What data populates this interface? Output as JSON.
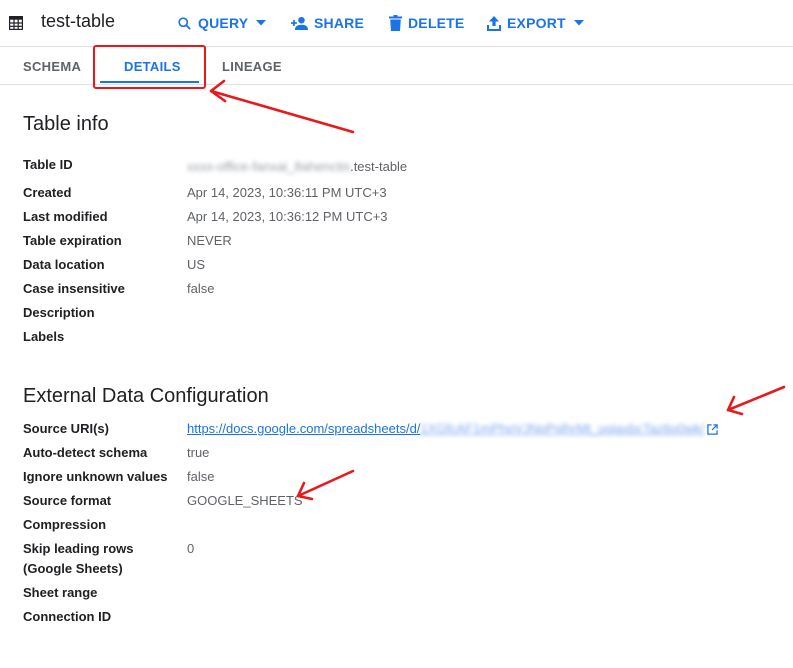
{
  "header": {
    "title": "test-table",
    "actions": {
      "query": "QUERY",
      "share": "SHARE",
      "delete": "DELETE",
      "export": "EXPORT"
    }
  },
  "tabs": {
    "schema": "SCHEMA",
    "details": "DETAILS",
    "lineage": "LINEAGE",
    "active": "DETAILS"
  },
  "table_info": {
    "title": "Table info",
    "rows": [
      {
        "label": "Table ID",
        "value_prefix": "xxxx-office-fanxai_8ahenctis",
        "value": ".test-table"
      },
      {
        "label": "Created",
        "value": "Apr 14, 2023, 10:36:11 PM UTC+3"
      },
      {
        "label": "Last modified",
        "value": "Apr 14, 2023, 10:36:12 PM UTC+3"
      },
      {
        "label": "Table expiration",
        "value": "NEVER"
      },
      {
        "label": "Data location",
        "value": "US"
      },
      {
        "label": "Case insensitive",
        "value": "false"
      },
      {
        "label": "Description",
        "value": ""
      },
      {
        "label": "Labels",
        "value": ""
      }
    ]
  },
  "external_config": {
    "title": "External Data Configuration",
    "rows": [
      {
        "label": "Source URI(s)",
        "value": "https://docs.google.com/spreadsheets/d/",
        "value_blurred": "1XGfcAF1mPhpVJNpPqlhrMt_ugiaxbcTaz6o0wk/"
      },
      {
        "label": "Auto-detect schema",
        "value": "true"
      },
      {
        "label": "Ignore unknown values",
        "value": "false"
      },
      {
        "label": "Source format",
        "value": "GOOGLE_SHEETS"
      },
      {
        "label": "Compression",
        "value": ""
      },
      {
        "label": "Skip leading rows",
        "label_line2": "(Google Sheets)",
        "value": "0"
      },
      {
        "label": "Sheet range",
        "value": ""
      },
      {
        "label": "Connection ID",
        "value": ""
      }
    ]
  },
  "colors": {
    "accent": "#1a73e8",
    "annotation": "#e8191b",
    "text": "#202124",
    "muted": "#5f6368"
  },
  "icons": [
    "table-icon",
    "search-icon",
    "person-add-icon",
    "trash-icon",
    "upload-icon",
    "caret-down-icon",
    "open-in-new-icon"
  ]
}
